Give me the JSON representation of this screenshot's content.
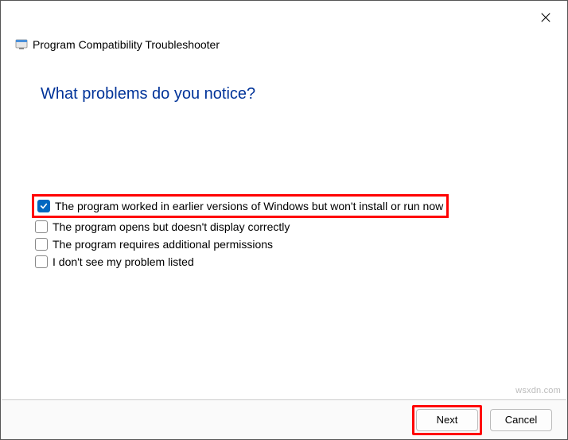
{
  "header": {
    "title": "Program Compatibility Troubleshooter"
  },
  "question": "What problems do you notice?",
  "options": [
    {
      "label": "The program worked in earlier versions of Windows but won't install or run now",
      "checked": true,
      "highlight": true
    },
    {
      "label": "The program opens but doesn't display correctly",
      "checked": false,
      "highlight": false
    },
    {
      "label": "The program requires additional permissions",
      "checked": false,
      "highlight": false
    },
    {
      "label": "I don't see my problem listed",
      "checked": false,
      "highlight": false
    }
  ],
  "footer": {
    "next_label": "Next",
    "cancel_label": "Cancel"
  },
  "watermark": "wsxdn.com"
}
